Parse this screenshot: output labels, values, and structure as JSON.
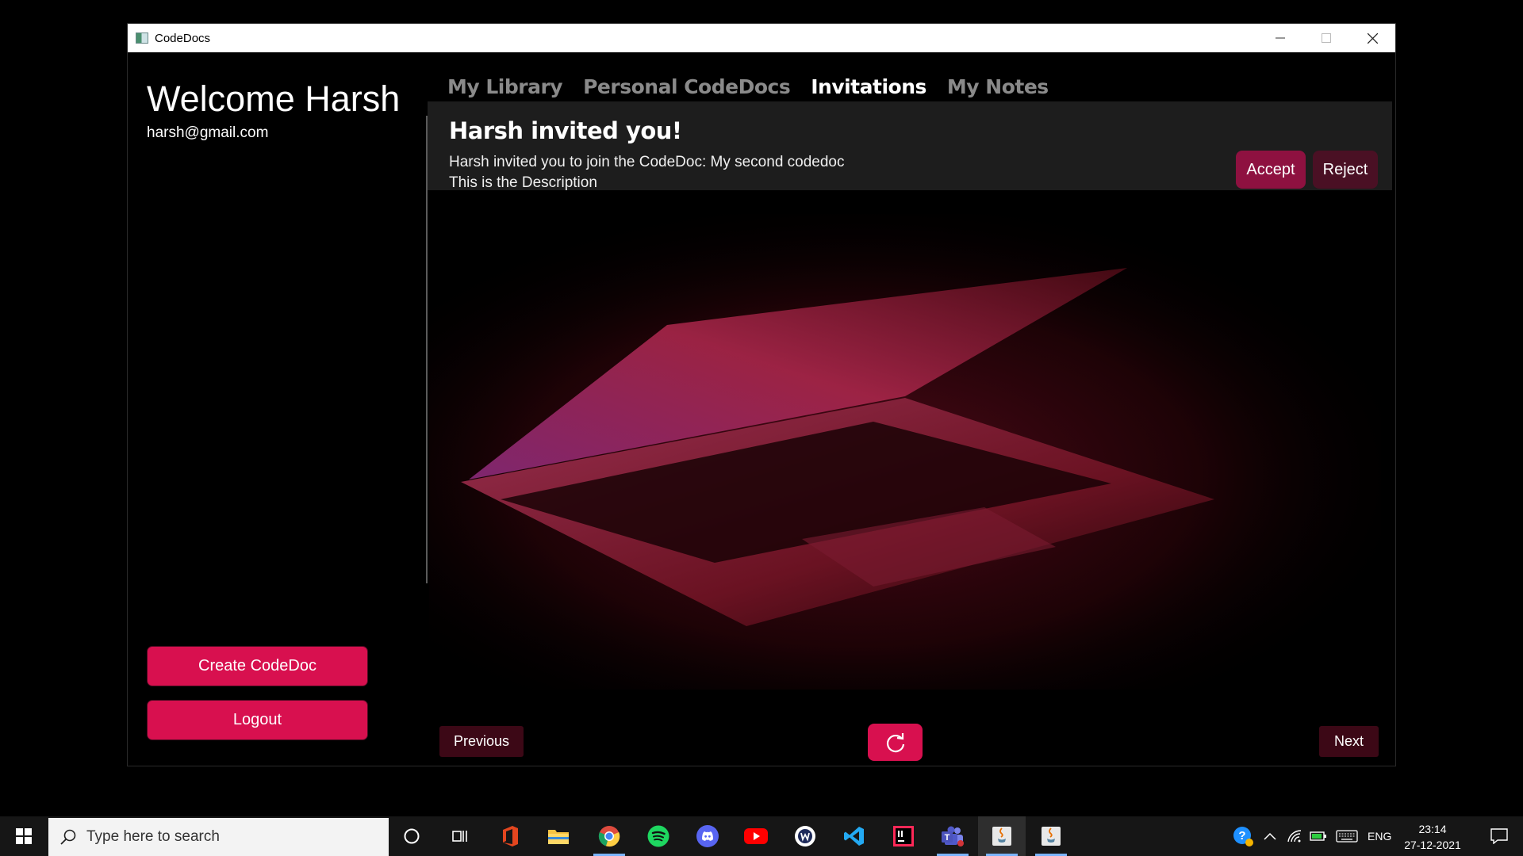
{
  "window": {
    "title": "CodeDocs"
  },
  "sidebar": {
    "welcome": "Welcome Harsh",
    "email": "harsh@gmail.com",
    "create_label": "Create CodeDoc",
    "logout_label": "Logout"
  },
  "tabs": [
    {
      "label": "My Library",
      "active": false
    },
    {
      "label": "Personal CodeDocs",
      "active": false
    },
    {
      "label": "Invitations",
      "active": true
    },
    {
      "label": "My Notes",
      "active": false
    }
  ],
  "invitation": {
    "title": "Harsh invited you!",
    "message": "Harsh invited you to join the CodeDoc: My second codedoc",
    "description": "This is the Description",
    "accept_label": "Accept",
    "reject_label": "Reject"
  },
  "pagination": {
    "previous_label": "Previous",
    "next_label": "Next"
  },
  "taskbar": {
    "search_placeholder": "Type here to search",
    "apps": [
      "cortana-icon",
      "task-view-icon",
      "office-icon",
      "file-explorer-icon",
      "chrome-icon",
      "spotify-icon",
      "discord-icon",
      "youtube-icon",
      "wordpad-icon",
      "vscode-icon",
      "intellij-icon",
      "teams-icon",
      "java-icon",
      "java-icon"
    ],
    "language": "ENG",
    "time": "23:14",
    "date": "27-12-2021"
  },
  "colors": {
    "accent": "#d8104f",
    "accept": "#8e1140",
    "reject": "#4a1024",
    "nav_button": "#3c0816"
  }
}
